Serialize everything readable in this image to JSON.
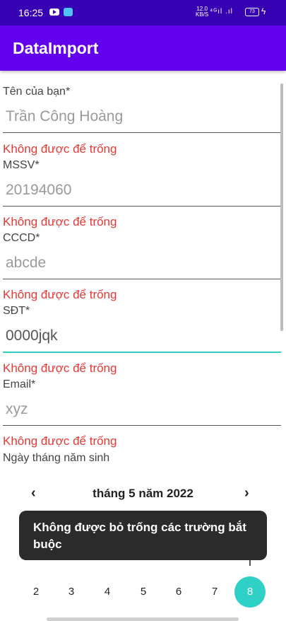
{
  "status_bar": {
    "time": "16:25",
    "speed_value": "12.0",
    "speed_unit": "KB/S",
    "signal": "⁴ᴳıl .ıl",
    "battery": "73"
  },
  "app_bar": {
    "title": "DataImport"
  },
  "form": {
    "name": {
      "label": "Tên của bạn*",
      "value": "Trần Công Hoàng",
      "error": "Không được để trống"
    },
    "mssv": {
      "label": "MSSV*",
      "value": "20194060",
      "error": "Không được để trống"
    },
    "cccd": {
      "label": "CCCD*",
      "value": "abcde",
      "error": "Không được để trống"
    },
    "sdt": {
      "label": "SĐT*",
      "value": "0000jqk",
      "error": "Không được để trống"
    },
    "email": {
      "label": "Email*",
      "value": "xyz",
      "error": "Không được để trống"
    },
    "dob": {
      "label": "Ngày tháng năm sinh"
    }
  },
  "calendar": {
    "prev": "‹",
    "title": "tháng 5 năm 2022",
    "next": "›",
    "days": [
      "2",
      "3",
      "4",
      "5",
      "6",
      "7"
    ],
    "selected_day": "8",
    "accent_color": "#2fd1c6"
  },
  "toast": {
    "message": "Không được bỏ trống các trường bắt buộc"
  },
  "colors": {
    "status_bar": "#3700b3",
    "app_bar": "#6200ee",
    "error": "#e53935"
  }
}
